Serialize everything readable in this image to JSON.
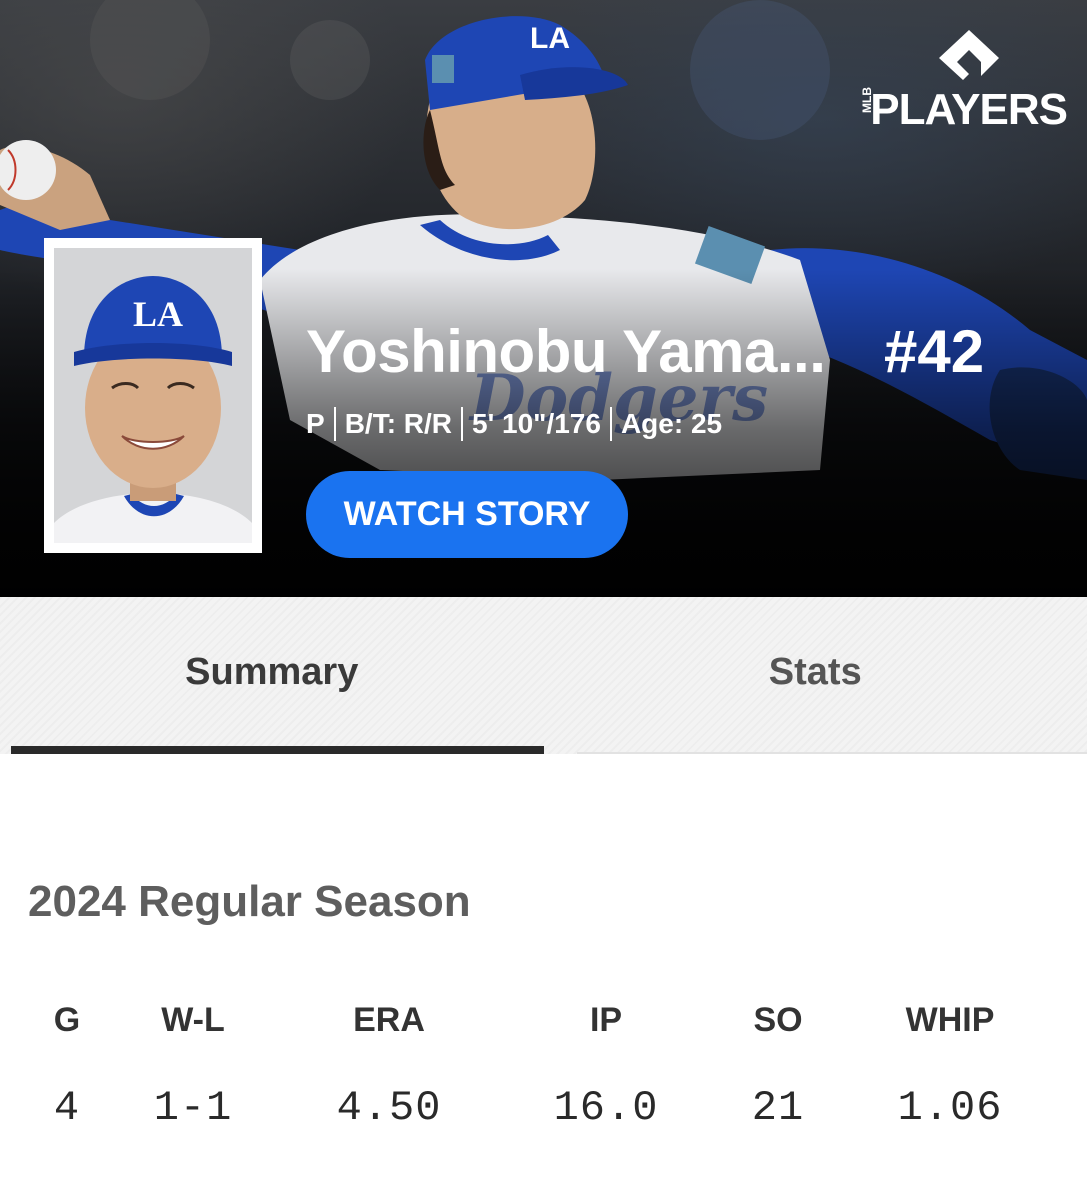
{
  "brand": {
    "logo_small": "MLB",
    "logo_text": "PLAYERS"
  },
  "player": {
    "name": "Yoshinobu Yama...",
    "number": "#42",
    "meta": [
      "P",
      "B/T: R/R",
      "5' 10\"/176",
      "Age: 25"
    ],
    "cap_logo": "LA",
    "jersey_script": "Dodgers"
  },
  "actions": {
    "watch_story": "WATCH STORY"
  },
  "tabs": [
    {
      "label": "Summary",
      "active": true
    },
    {
      "label": "Stats",
      "active": false
    }
  ],
  "season": {
    "title": "2024 Regular Season",
    "stats": [
      {
        "label": "G",
        "value": "4"
      },
      {
        "label": "W-L",
        "value": "1-1"
      },
      {
        "label": "ERA",
        "value": "4.50"
      },
      {
        "label": "IP",
        "value": "16.0"
      },
      {
        "label": "SO",
        "value": "21"
      },
      {
        "label": "WHIP",
        "value": "1.06"
      }
    ]
  },
  "colors": {
    "dodger_blue": "#1e50c8",
    "button_blue": "#1a73f0",
    "hero_dark": "#050506"
  }
}
